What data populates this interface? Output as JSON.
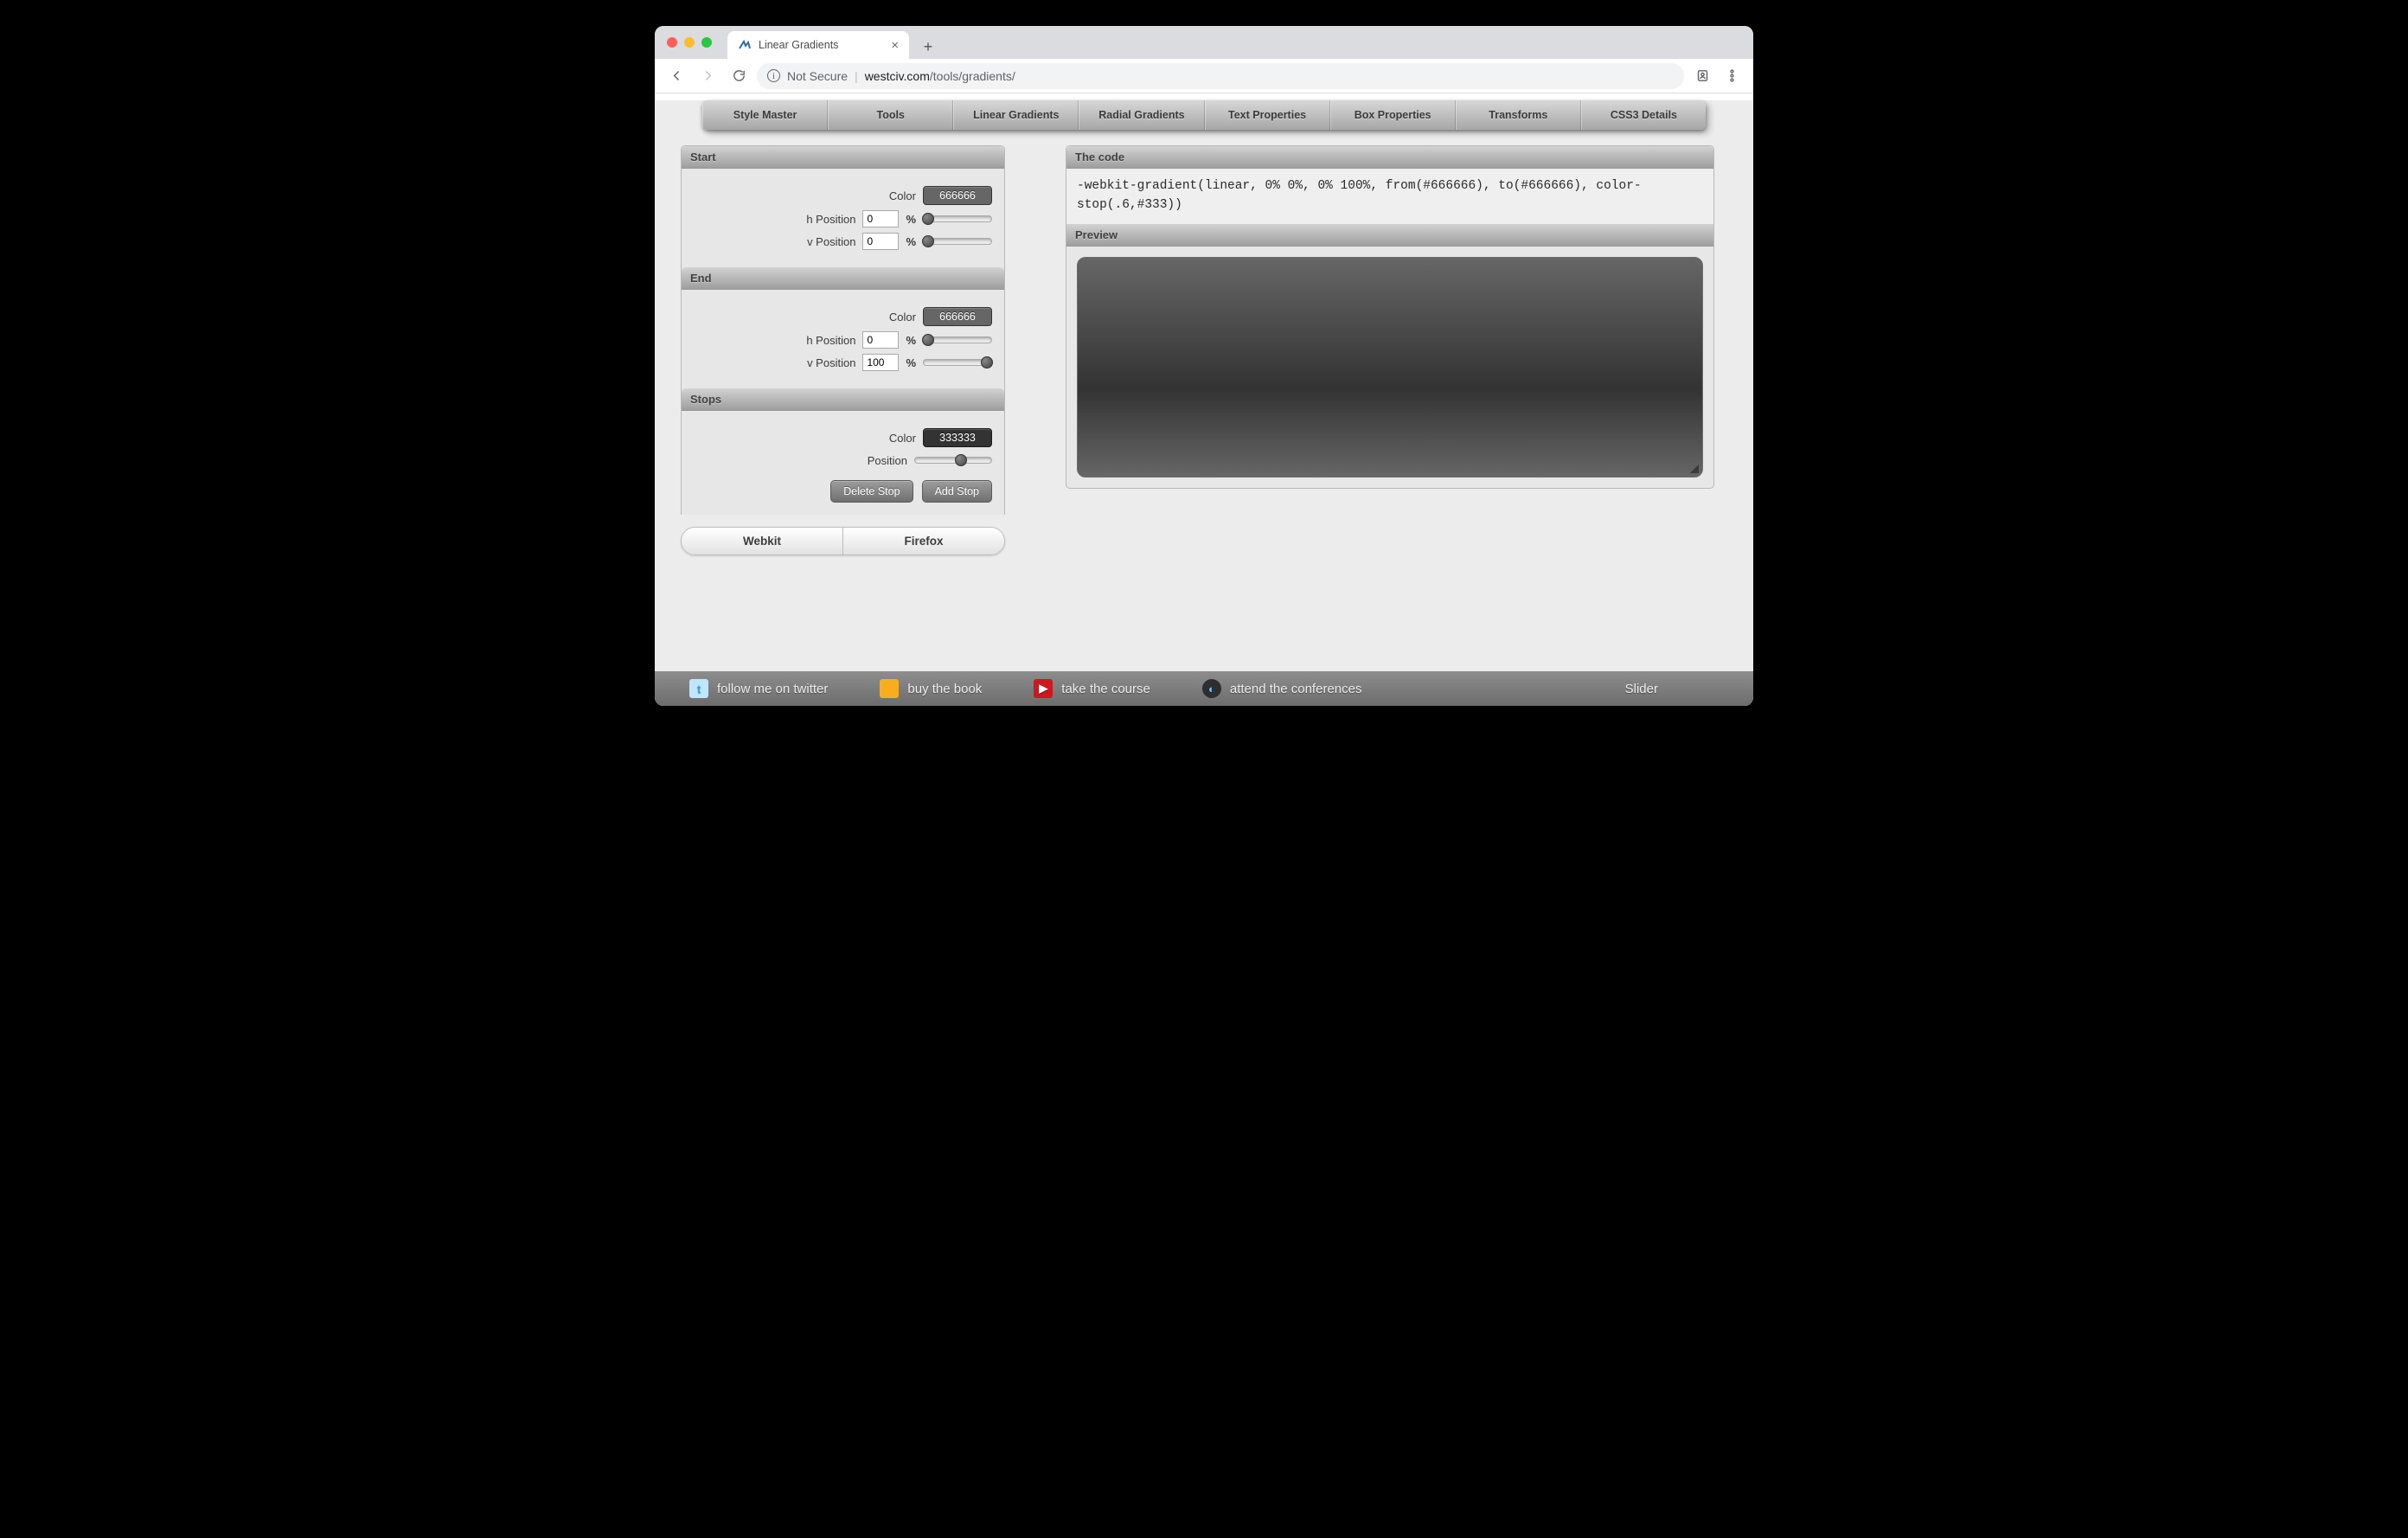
{
  "browser": {
    "tab_title": "Linear Gradients",
    "not_secure": "Not Secure",
    "host": "westciv.com",
    "path": "/tools/gradients/"
  },
  "nav": {
    "items": [
      "Style Master",
      "Tools",
      "Linear Gradients",
      "Radial Gradients",
      "Text Properties",
      "Box Properties",
      "Transforms",
      "CSS3 Details"
    ]
  },
  "start": {
    "title": "Start",
    "color_label": "Color",
    "color_value": "666666",
    "color_hex": "#666666",
    "hpos_label": "h Position",
    "hpos_value": "0",
    "vpos_label": "v Position",
    "vpos_value": "0",
    "unit": "%"
  },
  "end": {
    "title": "End",
    "color_label": "Color",
    "color_value": "666666",
    "color_hex": "#666666",
    "hpos_label": "h Position",
    "hpos_value": "0",
    "vpos_label": "v Position",
    "vpos_value": "100",
    "unit": "%"
  },
  "stops": {
    "title": "Stops",
    "color_label": "Color",
    "color_value": "333333",
    "color_hex": "#333333",
    "pos_label": "Position",
    "pos_value": 0.6,
    "delete_label": "Delete Stop",
    "add_label": "Add Stop"
  },
  "segmented": {
    "webkit": "Webkit",
    "firefox": "Firefox"
  },
  "code": {
    "title": "The code",
    "text": "-webkit-gradient(linear, 0% 0%, 0% 100%, from(#666666), to(#666666), color-stop(.6,#333))"
  },
  "preview": {
    "title": "Preview"
  },
  "footer": {
    "twitter": "follow me on twitter",
    "book": "buy the book",
    "course": "take the course",
    "conf": "attend the conferences",
    "slider": "Slider"
  }
}
